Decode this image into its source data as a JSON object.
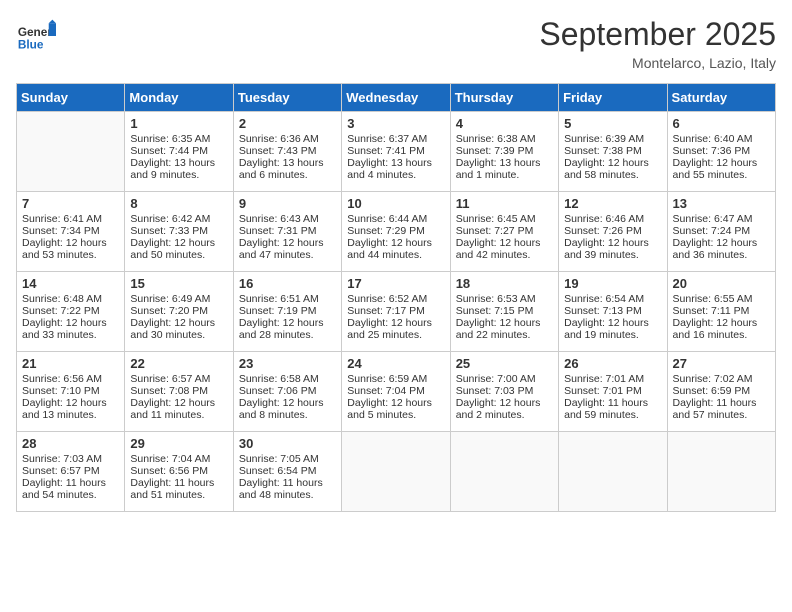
{
  "logo": {
    "general": "General",
    "blue": "Blue"
  },
  "header": {
    "title": "September 2025",
    "location": "Montelarco, Lazio, Italy"
  },
  "weekdays": [
    "Sunday",
    "Monday",
    "Tuesday",
    "Wednesday",
    "Thursday",
    "Friday",
    "Saturday"
  ],
  "weeks": [
    [
      {
        "day": "",
        "info": ""
      },
      {
        "day": "1",
        "info": "Sunrise: 6:35 AM\nSunset: 7:44 PM\nDaylight: 13 hours\nand 9 minutes."
      },
      {
        "day": "2",
        "info": "Sunrise: 6:36 AM\nSunset: 7:43 PM\nDaylight: 13 hours\nand 6 minutes."
      },
      {
        "day": "3",
        "info": "Sunrise: 6:37 AM\nSunset: 7:41 PM\nDaylight: 13 hours\nand 4 minutes."
      },
      {
        "day": "4",
        "info": "Sunrise: 6:38 AM\nSunset: 7:39 PM\nDaylight: 13 hours\nand 1 minute."
      },
      {
        "day": "5",
        "info": "Sunrise: 6:39 AM\nSunset: 7:38 PM\nDaylight: 12 hours\nand 58 minutes."
      },
      {
        "day": "6",
        "info": "Sunrise: 6:40 AM\nSunset: 7:36 PM\nDaylight: 12 hours\nand 55 minutes."
      }
    ],
    [
      {
        "day": "7",
        "info": "Sunrise: 6:41 AM\nSunset: 7:34 PM\nDaylight: 12 hours\nand 53 minutes."
      },
      {
        "day": "8",
        "info": "Sunrise: 6:42 AM\nSunset: 7:33 PM\nDaylight: 12 hours\nand 50 minutes."
      },
      {
        "day": "9",
        "info": "Sunrise: 6:43 AM\nSunset: 7:31 PM\nDaylight: 12 hours\nand 47 minutes."
      },
      {
        "day": "10",
        "info": "Sunrise: 6:44 AM\nSunset: 7:29 PM\nDaylight: 12 hours\nand 44 minutes."
      },
      {
        "day": "11",
        "info": "Sunrise: 6:45 AM\nSunset: 7:27 PM\nDaylight: 12 hours\nand 42 minutes."
      },
      {
        "day": "12",
        "info": "Sunrise: 6:46 AM\nSunset: 7:26 PM\nDaylight: 12 hours\nand 39 minutes."
      },
      {
        "day": "13",
        "info": "Sunrise: 6:47 AM\nSunset: 7:24 PM\nDaylight: 12 hours\nand 36 minutes."
      }
    ],
    [
      {
        "day": "14",
        "info": "Sunrise: 6:48 AM\nSunset: 7:22 PM\nDaylight: 12 hours\nand 33 minutes."
      },
      {
        "day": "15",
        "info": "Sunrise: 6:49 AM\nSunset: 7:20 PM\nDaylight: 12 hours\nand 30 minutes."
      },
      {
        "day": "16",
        "info": "Sunrise: 6:51 AM\nSunset: 7:19 PM\nDaylight: 12 hours\nand 28 minutes."
      },
      {
        "day": "17",
        "info": "Sunrise: 6:52 AM\nSunset: 7:17 PM\nDaylight: 12 hours\nand 25 minutes."
      },
      {
        "day": "18",
        "info": "Sunrise: 6:53 AM\nSunset: 7:15 PM\nDaylight: 12 hours\nand 22 minutes."
      },
      {
        "day": "19",
        "info": "Sunrise: 6:54 AM\nSunset: 7:13 PM\nDaylight: 12 hours\nand 19 minutes."
      },
      {
        "day": "20",
        "info": "Sunrise: 6:55 AM\nSunset: 7:11 PM\nDaylight: 12 hours\nand 16 minutes."
      }
    ],
    [
      {
        "day": "21",
        "info": "Sunrise: 6:56 AM\nSunset: 7:10 PM\nDaylight: 12 hours\nand 13 minutes."
      },
      {
        "day": "22",
        "info": "Sunrise: 6:57 AM\nSunset: 7:08 PM\nDaylight: 12 hours\nand 11 minutes."
      },
      {
        "day": "23",
        "info": "Sunrise: 6:58 AM\nSunset: 7:06 PM\nDaylight: 12 hours\nand 8 minutes."
      },
      {
        "day": "24",
        "info": "Sunrise: 6:59 AM\nSunset: 7:04 PM\nDaylight: 12 hours\nand 5 minutes."
      },
      {
        "day": "25",
        "info": "Sunrise: 7:00 AM\nSunset: 7:03 PM\nDaylight: 12 hours\nand 2 minutes."
      },
      {
        "day": "26",
        "info": "Sunrise: 7:01 AM\nSunset: 7:01 PM\nDaylight: 11 hours\nand 59 minutes."
      },
      {
        "day": "27",
        "info": "Sunrise: 7:02 AM\nSunset: 6:59 PM\nDaylight: 11 hours\nand 57 minutes."
      }
    ],
    [
      {
        "day": "28",
        "info": "Sunrise: 7:03 AM\nSunset: 6:57 PM\nDaylight: 11 hours\nand 54 minutes."
      },
      {
        "day": "29",
        "info": "Sunrise: 7:04 AM\nSunset: 6:56 PM\nDaylight: 11 hours\nand 51 minutes."
      },
      {
        "day": "30",
        "info": "Sunrise: 7:05 AM\nSunset: 6:54 PM\nDaylight: 11 hours\nand 48 minutes."
      },
      {
        "day": "",
        "info": ""
      },
      {
        "day": "",
        "info": ""
      },
      {
        "day": "",
        "info": ""
      },
      {
        "day": "",
        "info": ""
      }
    ]
  ]
}
